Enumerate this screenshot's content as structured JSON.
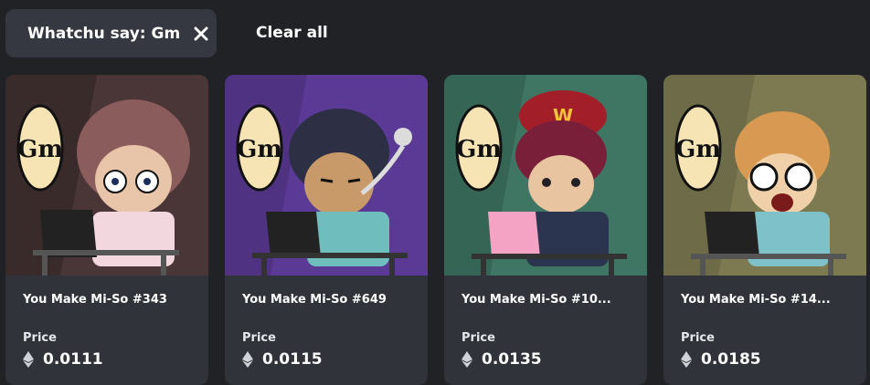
{
  "filters": {
    "active_chip_label": "Whatchu say: Gm",
    "clear_all_label": "Clear all"
  },
  "cards": [
    {
      "name": "You Make Mi-So #343",
      "price_label": "Price",
      "price": "0.0111",
      "bg_color": "#4a3636",
      "hair_color": "#8b5c5c",
      "laptop_color": "#222222"
    },
    {
      "name": "You Make Mi-So #649",
      "price_label": "Price",
      "price": "0.0115",
      "bg_color": "#5b3a95",
      "hair_color": "#2d2f45",
      "laptop_color": "#222222"
    },
    {
      "name": "You Make Mi-So #10...",
      "price_label": "Price",
      "price": "0.0135",
      "bg_color": "#3f7563",
      "hair_color": "#7a1f3a",
      "laptop_color": "#f4a3c4"
    },
    {
      "name": "You Make Mi-So #14...",
      "price_label": "Price",
      "price": "0.0185",
      "bg_color": "#7d7a52",
      "hair_color": "#d89a52",
      "laptop_color": "#222222"
    }
  ],
  "icons": {
    "chip_close": "close-icon",
    "currency": "ethereum-icon",
    "speech": "gm-speech-bubble"
  }
}
